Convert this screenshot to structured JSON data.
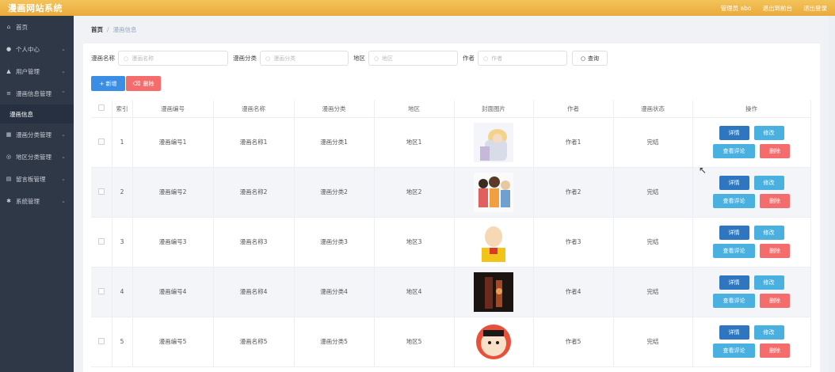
{
  "header": {
    "title": "漫画网站系统",
    "admin_text": "管理员 abo",
    "logout_to_front": "退出到前台",
    "logout": "退出登录"
  },
  "sidebar": {
    "items": [
      {
        "label": "首页",
        "icon": "home-icon"
      },
      {
        "label": "个人中心",
        "icon": "user-icon"
      },
      {
        "label": "用户管理",
        "icon": "users-icon"
      },
      {
        "label": "漫画信息管理",
        "icon": "book-icon",
        "children": [
          "漫画信息"
        ]
      },
      {
        "label": "漫画分类管理",
        "icon": "grid-icon"
      },
      {
        "label": "地区分类管理",
        "icon": "globe-icon"
      },
      {
        "label": "留言板管理",
        "icon": "message-icon"
      },
      {
        "label": "系统管理",
        "icon": "settings-icon"
      }
    ]
  },
  "breadcrumb": {
    "home": "首页",
    "separator": "/",
    "current": "漫画信息"
  },
  "search": {
    "name_label": "漫画名称",
    "name_placeholder": "漫画名称",
    "category_label": "漫画分类",
    "category_placeholder": "漫画分类",
    "region_label": "地区",
    "region_placeholder": "地区",
    "author_label": "作者",
    "author_placeholder": "作者",
    "query_button": "查询"
  },
  "toolbar": {
    "add_label": "+ 新增",
    "delete_label": "删除"
  },
  "table": {
    "columns": [
      "索引",
      "漫画编号",
      "漫画名称",
      "漫画分类",
      "地区",
      "封面图片",
      "作者",
      "漫画状态",
      "操作"
    ],
    "rows": [
      {
        "index": "1",
        "code": "漫画编号1",
        "name": "漫画名称1",
        "category": "漫画分类1",
        "region": "地区1",
        "author": "作者1",
        "status": "完结"
      },
      {
        "index": "2",
        "code": "漫画编号2",
        "name": "漫画名称2",
        "category": "漫画分类2",
        "region": "地区2",
        "author": "作者2",
        "status": "完结"
      },
      {
        "index": "3",
        "code": "漫画编号3",
        "name": "漫画名称3",
        "category": "漫画分类3",
        "region": "地区3",
        "author": "作者3",
        "status": "完结"
      },
      {
        "index": "4",
        "code": "漫画编号4",
        "name": "漫画名称4",
        "category": "漫画分类4",
        "region": "地区4",
        "author": "作者4",
        "status": "完结"
      },
      {
        "index": "5",
        "code": "漫画编号5",
        "name": "漫画名称5",
        "category": "漫画分类5",
        "region": "地区5",
        "author": "作者5",
        "status": "完结"
      }
    ],
    "ops": {
      "detail": "详情",
      "edit": "修改",
      "comment": "查看评论",
      "delete": "删除"
    }
  },
  "colors": {
    "header": "#f0b84c",
    "sidebar": "#2f3847",
    "primary": "#3a8ee6",
    "danger": "#f56c6c",
    "info": "#4ab0e0"
  }
}
